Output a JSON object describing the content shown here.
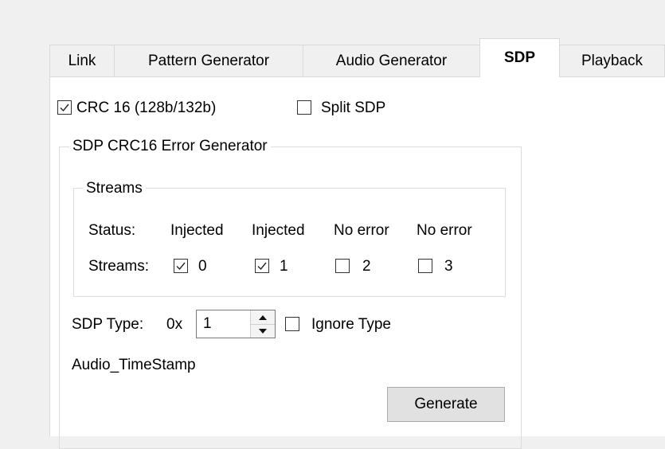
{
  "tabs": [
    {
      "label": "Link"
    },
    {
      "label": "Pattern Generator"
    },
    {
      "label": "Audio Generator"
    },
    {
      "label": "SDP",
      "active": true
    },
    {
      "label": "Playback"
    }
  ],
  "options": {
    "crc16": {
      "label": "CRC 16 (128b/132b)",
      "checked": true
    },
    "split_sdp": {
      "label": "Split SDP",
      "checked": false
    }
  },
  "error_generator": {
    "title": "SDP CRC16 Error Generator",
    "streams_group": {
      "title": "Streams",
      "status_label": "Status:",
      "statuses": [
        "Injected",
        "Injected",
        "No error",
        "No error"
      ],
      "streams_label": "Streams:",
      "streams": [
        {
          "label": "0",
          "checked": true
        },
        {
          "label": "1",
          "checked": true
        },
        {
          "label": "2",
          "checked": false
        },
        {
          "label": "3",
          "checked": false
        }
      ]
    },
    "sdp_type_label": "SDP Type:",
    "sdp_type_prefix": "0x",
    "sdp_type_value": "1",
    "ignore_type": {
      "label": "Ignore Type",
      "checked": false
    },
    "type_name": "Audio_TimeStamp",
    "generate_label": "Generate"
  },
  "icons": {
    "check": "checkmark-icon",
    "spin_up": "triangle-up-icon",
    "spin_down": "triangle-down-icon"
  }
}
